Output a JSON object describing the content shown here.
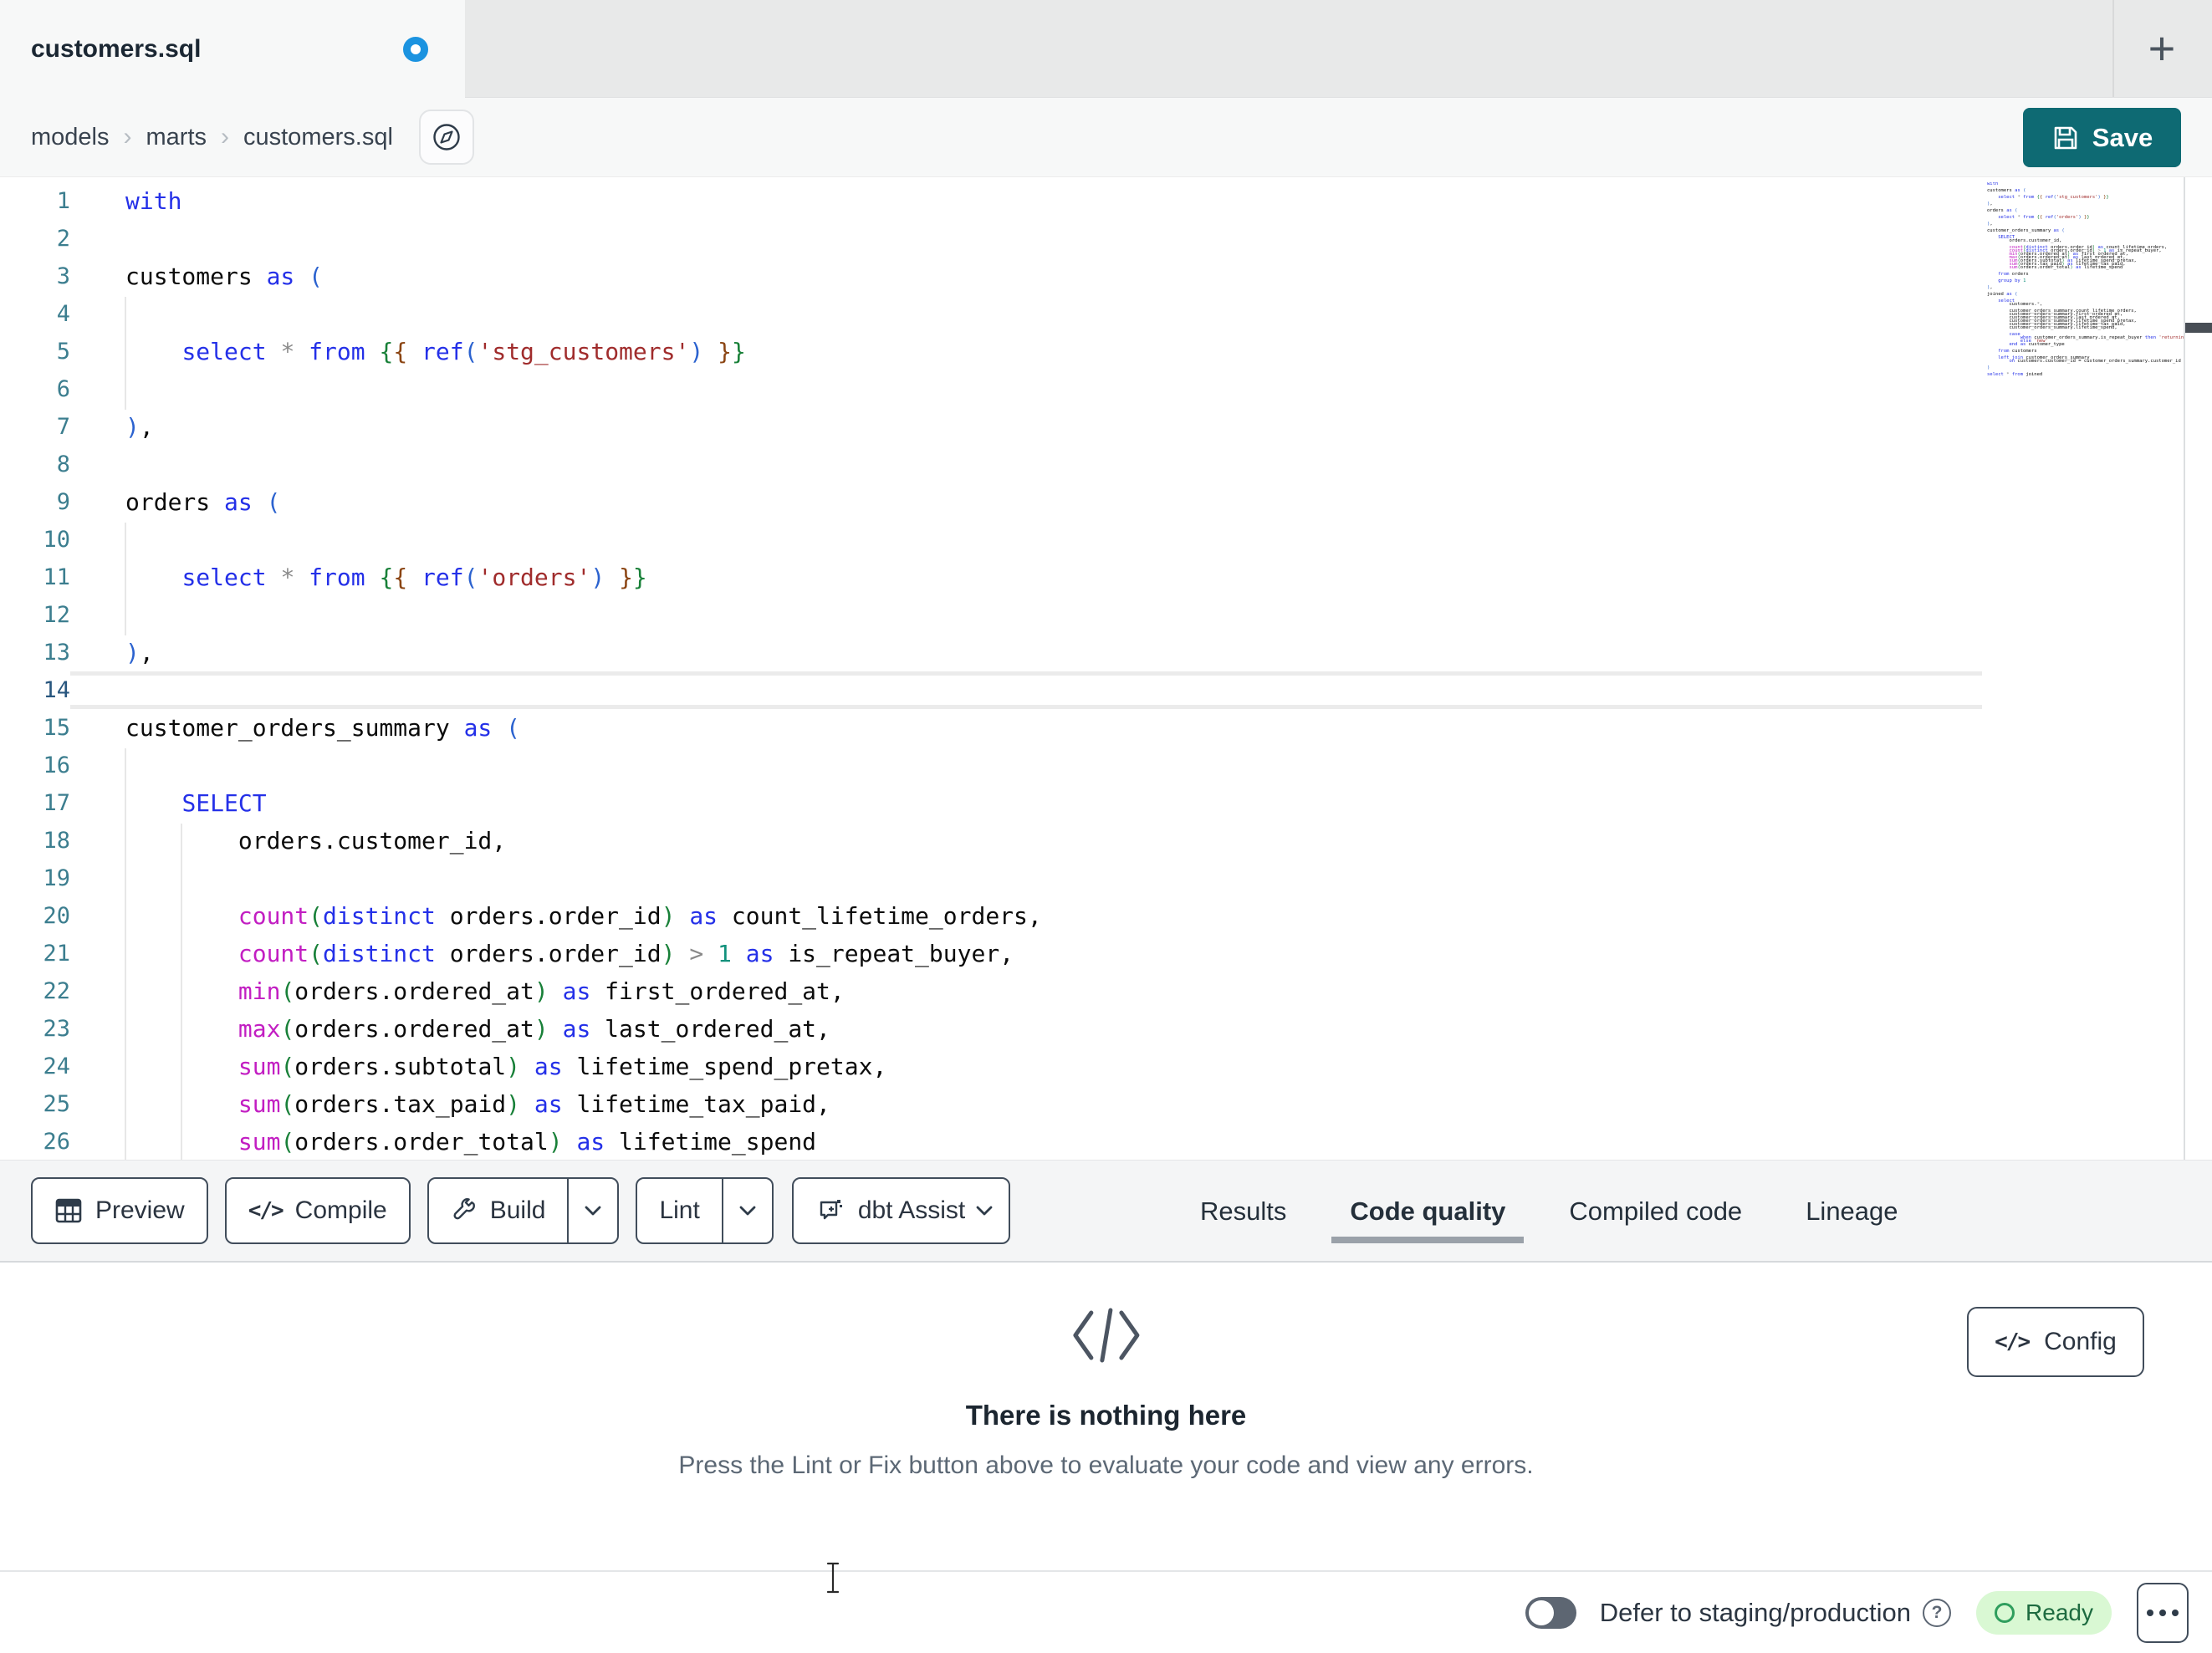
{
  "tab_bar": {
    "title": "customers.sql",
    "unsaved": true,
    "plus": "+"
  },
  "breadcrumb": {
    "items": [
      "models",
      "marts",
      "customers.sql"
    ],
    "separator": "›"
  },
  "save_button": {
    "label": "Save"
  },
  "editor": {
    "active_line": 14,
    "lines": [
      {
        "n": 1,
        "t": [
          [
            "kw",
            "with"
          ]
        ]
      },
      {
        "n": 2,
        "t": []
      },
      {
        "n": 3,
        "t": [
          [
            "id",
            "customers "
          ],
          [
            "kw",
            "as"
          ],
          [
            "id",
            " "
          ],
          [
            "b",
            "("
          ]
        ]
      },
      {
        "n": 4,
        "t": []
      },
      {
        "n": 5,
        "t": [
          [
            "id",
            "    "
          ],
          [
            "kw",
            "select"
          ],
          [
            "id",
            " "
          ],
          [
            "op",
            "*"
          ],
          [
            "id",
            " "
          ],
          [
            "kw",
            "from"
          ],
          [
            "id",
            " "
          ],
          [
            "g",
            "{"
          ],
          [
            "br",
            "{"
          ],
          [
            "id",
            " "
          ],
          [
            "kw",
            "ref"
          ],
          [
            "b",
            "("
          ],
          [
            "str",
            "'stg_customers'"
          ],
          [
            "b",
            ")"
          ],
          [
            "id",
            " "
          ],
          [
            "br",
            "}"
          ],
          [
            "g",
            "}"
          ]
        ]
      },
      {
        "n": 6,
        "t": []
      },
      {
        "n": 7,
        "t": [
          [
            "b",
            ")"
          ],
          [
            "id",
            ","
          ]
        ]
      },
      {
        "n": 8,
        "t": []
      },
      {
        "n": 9,
        "t": [
          [
            "id",
            "orders "
          ],
          [
            "kw",
            "as"
          ],
          [
            "id",
            " "
          ],
          [
            "b",
            "("
          ]
        ]
      },
      {
        "n": 10,
        "t": []
      },
      {
        "n": 11,
        "t": [
          [
            "id",
            "    "
          ],
          [
            "kw",
            "select"
          ],
          [
            "id",
            " "
          ],
          [
            "op",
            "*"
          ],
          [
            "id",
            " "
          ],
          [
            "kw",
            "from"
          ],
          [
            "id",
            " "
          ],
          [
            "g",
            "{"
          ],
          [
            "br",
            "{"
          ],
          [
            "id",
            " "
          ],
          [
            "kw",
            "ref"
          ],
          [
            "b",
            "("
          ],
          [
            "str",
            "'orders'"
          ],
          [
            "b",
            ")"
          ],
          [
            "id",
            " "
          ],
          [
            "br",
            "}"
          ],
          [
            "g",
            "}"
          ]
        ]
      },
      {
        "n": 12,
        "t": []
      },
      {
        "n": 13,
        "t": [
          [
            "b",
            ")"
          ],
          [
            "id",
            ","
          ]
        ]
      },
      {
        "n": 14,
        "t": []
      },
      {
        "n": 15,
        "t": [
          [
            "id",
            "customer_orders_summary "
          ],
          [
            "kw",
            "as"
          ],
          [
            "id",
            " "
          ],
          [
            "b",
            "("
          ]
        ]
      },
      {
        "n": 16,
        "t": []
      },
      {
        "n": 17,
        "t": [
          [
            "id",
            "    "
          ],
          [
            "kw",
            "SELECT"
          ]
        ]
      },
      {
        "n": 18,
        "t": [
          [
            "id",
            "        orders.customer_id,"
          ]
        ]
      },
      {
        "n": 19,
        "t": []
      },
      {
        "n": 20,
        "t": [
          [
            "id",
            "        "
          ],
          [
            "fn",
            "count"
          ],
          [
            "g",
            "("
          ],
          [
            "kw",
            "distinct"
          ],
          [
            "id",
            " orders.order_id"
          ],
          [
            "g",
            ")"
          ],
          [
            "id",
            " "
          ],
          [
            "kw",
            "as"
          ],
          [
            "id",
            " count_lifetime_orders,"
          ]
        ]
      },
      {
        "n": 21,
        "t": [
          [
            "id",
            "        "
          ],
          [
            "fn",
            "count"
          ],
          [
            "g",
            "("
          ],
          [
            "kw",
            "distinct"
          ],
          [
            "id",
            " orders.order_id"
          ],
          [
            "g",
            ")"
          ],
          [
            "id",
            " "
          ],
          [
            "op",
            ">"
          ],
          [
            "id",
            " "
          ],
          [
            "num",
            "1"
          ],
          [
            "id",
            " "
          ],
          [
            "kw",
            "as"
          ],
          [
            "id",
            " is_repeat_buyer,"
          ]
        ]
      },
      {
        "n": 22,
        "t": [
          [
            "id",
            "        "
          ],
          [
            "fn",
            "min"
          ],
          [
            "g",
            "("
          ],
          [
            "id",
            "orders.ordered_at"
          ],
          [
            "g",
            ")"
          ],
          [
            "id",
            " "
          ],
          [
            "kw",
            "as"
          ],
          [
            "id",
            " first_ordered_at,"
          ]
        ]
      },
      {
        "n": 23,
        "t": [
          [
            "id",
            "        "
          ],
          [
            "fn",
            "max"
          ],
          [
            "g",
            "("
          ],
          [
            "id",
            "orders.ordered_at"
          ],
          [
            "g",
            ")"
          ],
          [
            "id",
            " "
          ],
          [
            "kw",
            "as"
          ],
          [
            "id",
            " last_ordered_at,"
          ]
        ]
      },
      {
        "n": 24,
        "t": [
          [
            "id",
            "        "
          ],
          [
            "fn",
            "sum"
          ],
          [
            "g",
            "("
          ],
          [
            "id",
            "orders.subtotal"
          ],
          [
            "g",
            ")"
          ],
          [
            "id",
            " "
          ],
          [
            "kw",
            "as"
          ],
          [
            "id",
            " lifetime_spend_pretax,"
          ]
        ]
      },
      {
        "n": 25,
        "t": [
          [
            "id",
            "        "
          ],
          [
            "fn",
            "sum"
          ],
          [
            "g",
            "("
          ],
          [
            "id",
            "orders.tax_paid"
          ],
          [
            "g",
            ")"
          ],
          [
            "id",
            " "
          ],
          [
            "kw",
            "as"
          ],
          [
            "id",
            " lifetime_tax_paid,"
          ]
        ]
      },
      {
        "n": 26,
        "t": [
          [
            "id",
            "        "
          ],
          [
            "fn",
            "sum"
          ],
          [
            "g",
            "("
          ],
          [
            "id",
            "orders.order_total"
          ],
          [
            "g",
            ")"
          ],
          [
            "id",
            " "
          ],
          [
            "kw",
            "as"
          ],
          [
            "id",
            " lifetime_spend"
          ]
        ]
      }
    ],
    "minimap_extra": [
      {
        "n": 27,
        "t": []
      },
      {
        "n": 28,
        "t": [
          [
            "id",
            "    "
          ],
          [
            "kw",
            "from"
          ],
          [
            "id",
            " orders"
          ]
        ]
      },
      {
        "n": 29,
        "t": []
      },
      {
        "n": 30,
        "t": [
          [
            "id",
            "    "
          ],
          [
            "kw",
            "group by"
          ],
          [
            "id",
            " "
          ],
          [
            "num",
            "1"
          ]
        ]
      },
      {
        "n": 31,
        "t": []
      },
      {
        "n": 32,
        "t": [
          [
            "b",
            ")"
          ],
          [
            "id",
            ","
          ]
        ]
      },
      {
        "n": 33,
        "t": []
      },
      {
        "n": 34,
        "t": [
          [
            "id",
            "joined "
          ],
          [
            "kw",
            "as"
          ],
          [
            "id",
            " "
          ],
          [
            "b",
            "("
          ]
        ]
      },
      {
        "n": 35,
        "t": []
      },
      {
        "n": 36,
        "t": [
          [
            "id",
            "    "
          ],
          [
            "kw",
            "select"
          ]
        ]
      },
      {
        "n": 37,
        "t": [
          [
            "id",
            "        customers."
          ],
          [
            "op",
            "*"
          ],
          [
            "id",
            ","
          ]
        ]
      },
      {
        "n": 38,
        "t": []
      },
      {
        "n": 39,
        "t": [
          [
            "id",
            "        customer_orders_summary.count_lifetime_orders,"
          ]
        ]
      },
      {
        "n": 40,
        "t": [
          [
            "id",
            "        customer_orders_summary.first_ordered_at,"
          ]
        ]
      },
      {
        "n": 41,
        "t": [
          [
            "id",
            "        customer_orders_summary.last_ordered_at,"
          ]
        ]
      },
      {
        "n": 42,
        "t": [
          [
            "id",
            "        customer_orders_summary.lifetime_spend_pretax,"
          ]
        ]
      },
      {
        "n": 43,
        "t": [
          [
            "id",
            "        customer_orders_summary.lifetime_tax_paid,"
          ]
        ]
      },
      {
        "n": 44,
        "t": [
          [
            "id",
            "        customer_orders_summary.lifetime_spend,"
          ]
        ]
      },
      {
        "n": 45,
        "t": []
      },
      {
        "n": 46,
        "t": [
          [
            "id",
            "        "
          ],
          [
            "kw",
            "case"
          ]
        ]
      },
      {
        "n": 47,
        "t": [
          [
            "id",
            "            "
          ],
          [
            "kw",
            "when"
          ],
          [
            "id",
            " customer_orders_summary.is_repeat_buyer "
          ],
          [
            "kw",
            "then"
          ],
          [
            "id",
            " "
          ],
          [
            "str",
            "'returning'"
          ]
        ]
      },
      {
        "n": 48,
        "t": [
          [
            "id",
            "            "
          ],
          [
            "kw",
            "else"
          ],
          [
            "id",
            " "
          ],
          [
            "str",
            "'new'"
          ]
        ]
      },
      {
        "n": 49,
        "t": [
          [
            "id",
            "        "
          ],
          [
            "kw",
            "end"
          ],
          [
            "id",
            " "
          ],
          [
            "kw",
            "as"
          ],
          [
            "id",
            " customer_type"
          ]
        ]
      },
      {
        "n": 50,
        "t": []
      },
      {
        "n": 51,
        "t": [
          [
            "id",
            "    "
          ],
          [
            "kw",
            "from"
          ],
          [
            "id",
            " customers"
          ]
        ]
      },
      {
        "n": 52,
        "t": []
      },
      {
        "n": 53,
        "t": [
          [
            "id",
            "    "
          ],
          [
            "kw",
            "left join"
          ],
          [
            "id",
            " customer_orders_summary"
          ]
        ]
      },
      {
        "n": 54,
        "t": [
          [
            "id",
            "        "
          ],
          [
            "kw",
            "on"
          ],
          [
            "id",
            " customers.customer_id = customer_orders_summary.customer_id"
          ]
        ]
      },
      {
        "n": 55,
        "t": []
      },
      {
        "n": 56,
        "t": [
          [
            "b",
            ")"
          ]
        ]
      },
      {
        "n": 57,
        "t": []
      },
      {
        "n": 58,
        "t": [
          [
            "kw",
            "select"
          ],
          [
            "id",
            " "
          ],
          [
            "op",
            "*"
          ],
          [
            "id",
            " "
          ],
          [
            "kw",
            "from"
          ],
          [
            "id",
            " joined"
          ]
        ]
      }
    ]
  },
  "toolbar": {
    "preview_label": "Preview",
    "compile_label": "Compile",
    "build_label": "Build",
    "lint_label": "Lint",
    "assist_label": "dbt Assist",
    "compile_glyph": "</>"
  },
  "panel_tabs": {
    "items": [
      {
        "label": "Results",
        "active": false
      },
      {
        "label": "Code quality",
        "active": true
      },
      {
        "label": "Compiled code",
        "active": false
      },
      {
        "label": "Lineage",
        "active": false
      }
    ]
  },
  "results_panel": {
    "title": "There is nothing here",
    "message": "Press the Lint or Fix button above to evaluate your code and view any errors.",
    "config_label": "Config",
    "config_glyph": "</>"
  },
  "status_bar": {
    "defer_label": "Defer to staging/production",
    "help_glyph": "?",
    "ready_label": "Ready"
  },
  "colors": {
    "save": "#0e6a73",
    "dotblue": "#1b93e0",
    "ckw": "#2430e8",
    "cfn": "#c21ec2",
    "cstr": "#a02c2c",
    "cnum": "#11917c",
    "cop": "#8a8a8a",
    "cb1": "#2b62cf",
    "cb2": "#188038",
    "cb3": "#8b4513",
    "cid": "#0b0b0b",
    "cln": "#3c7e8f",
    "readybg": "#d9f8d3",
    "readyring": "#2f9e5d",
    "readytext": "#1d6b40"
  }
}
